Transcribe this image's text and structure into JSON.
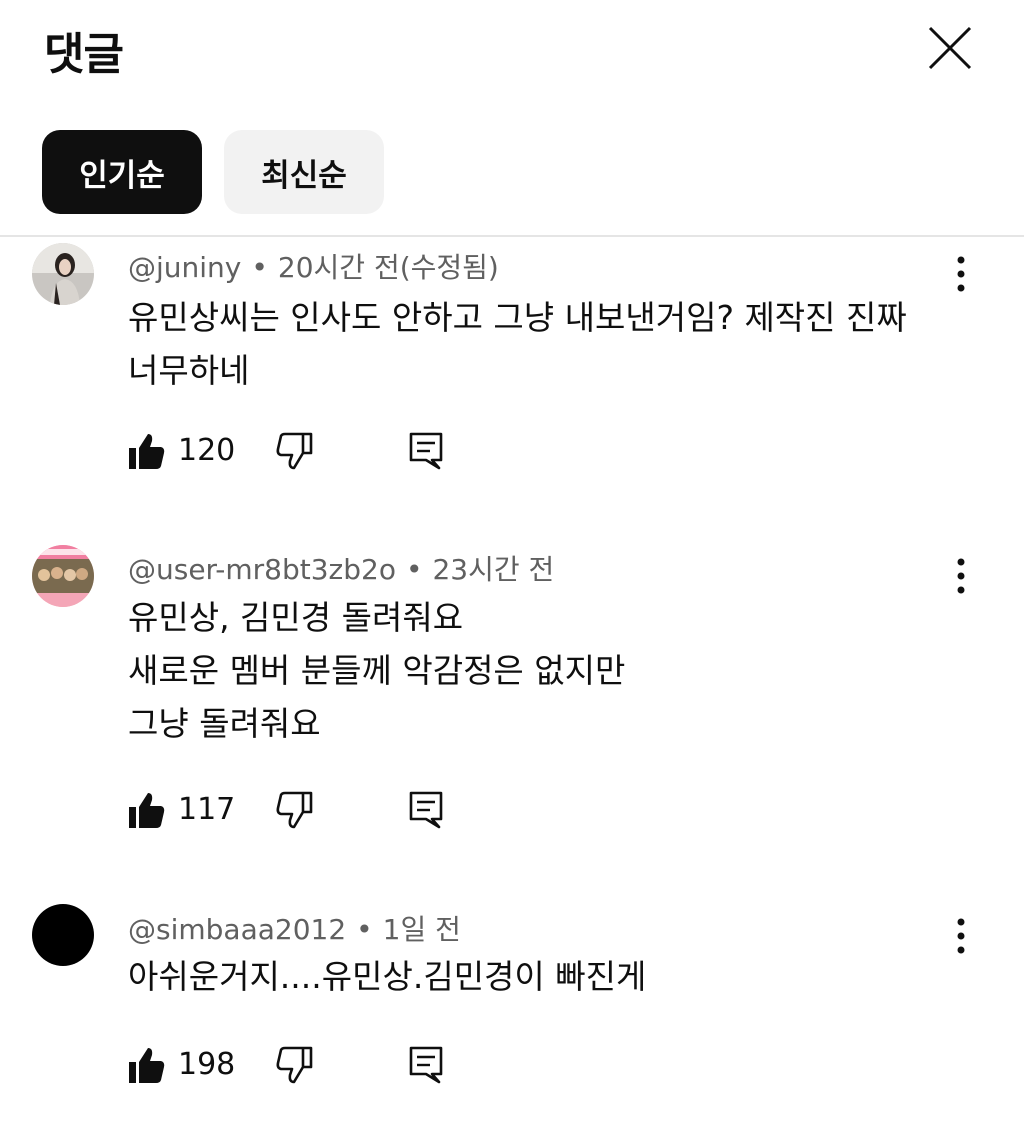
{
  "header": {
    "title": "댓글"
  },
  "sort_chips": [
    {
      "label": "인기순",
      "active": true
    },
    {
      "label": "최신순",
      "active": false
    }
  ],
  "comments": [
    {
      "author": "@juniny",
      "time": "20시간 전(수정됨)",
      "lines": [
        "유민상씨는 인사도 안하고 그냥 내보낸거임? 제작진 진짜",
        "너무하네"
      ],
      "likes": "120"
    },
    {
      "author": "@user-mr8bt3zb2o",
      "time": "23시간 전",
      "lines": [
        "유민상, 김민경 돌려줘요",
        "새로운 멤버 분들께 악감정은 없지만",
        "그냥 돌려줘요"
      ],
      "likes": "117"
    },
    {
      "author": "@simbaaa2012",
      "time": "1일 전",
      "lines": [
        "아쉬운거지....유민상.김민경이 빠진게"
      ],
      "likes": "198"
    }
  ],
  "icons": {
    "like": "thumbs-up-icon",
    "dislike": "thumbs-down-icon",
    "reply": "reply-icon",
    "more": "more-vert-icon",
    "close": "close-icon"
  }
}
